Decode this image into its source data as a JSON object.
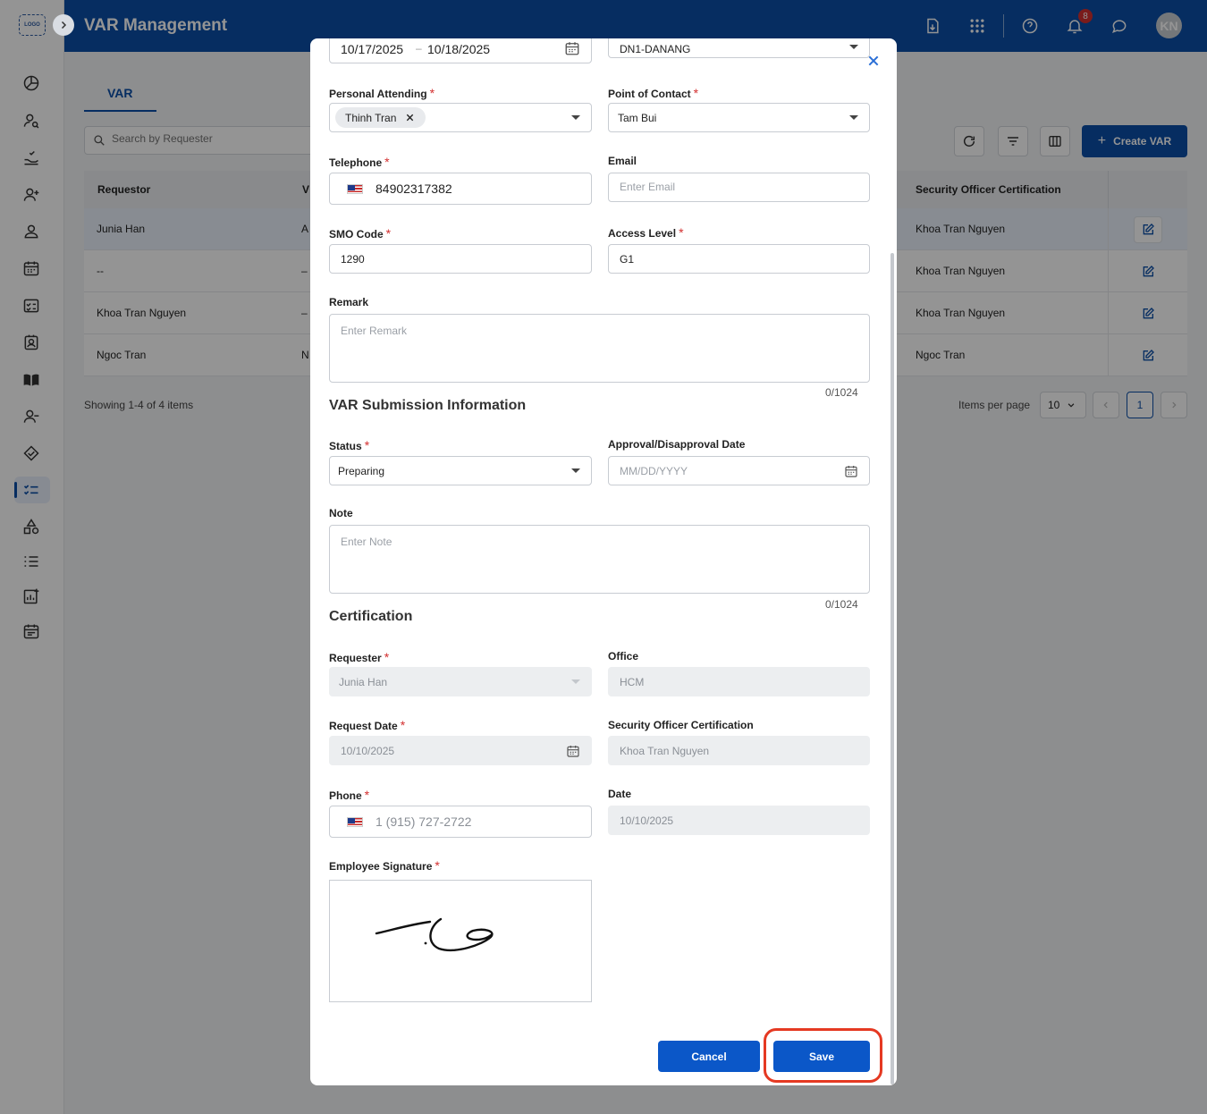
{
  "app": {
    "title": "VAR Management",
    "logo": "LOGO",
    "notification_count": "8",
    "avatar_initials": "KN"
  },
  "tabs": [
    {
      "label": "VAR"
    }
  ],
  "search": {
    "placeholder": "Search by Requester"
  },
  "toolbar": {
    "create_label": "Create VAR"
  },
  "table": {
    "headers": {
      "requestor": "Requestor",
      "v": "V",
      "soc": "Security Officer Certification"
    },
    "rows": [
      {
        "requestor": "Junia Han",
        "v": "A",
        "soc": "Khoa Tran Nguyen"
      },
      {
        "requestor": "--",
        "v": "–",
        "soc": "Khoa Tran Nguyen"
      },
      {
        "requestor": "Khoa Tran Nguyen",
        "v": "–",
        "soc": "Khoa Tran Nguyen"
      },
      {
        "requestor": "Ngoc Tran",
        "v": "N",
        "soc": "Ngoc Tran"
      }
    ]
  },
  "pagination": {
    "showing": "Showing 1-4 of 4 items",
    "items_per_page_label": "Items per page",
    "items_per_page": "10",
    "current_page": "1"
  },
  "modal": {
    "date_range": {
      "start": "10/17/2025",
      "separator": "–",
      "end": "10/18/2025"
    },
    "location": {
      "value": "DN1-DANANG"
    },
    "personal_attending": {
      "label": "Personal Attending",
      "chip": "Thinh Tran"
    },
    "point_of_contact": {
      "label": "Point of Contact",
      "value": "Tam Bui"
    },
    "telephone": {
      "label": "Telephone",
      "value": "84902317382"
    },
    "email": {
      "label": "Email",
      "placeholder": "Enter Email"
    },
    "smo_code": {
      "label": "SMO Code",
      "value": "1290"
    },
    "access_level": {
      "label": "Access Level",
      "value": "G1"
    },
    "remark": {
      "label": "Remark",
      "placeholder": "Enter Remark",
      "counter": "0/1024"
    },
    "submission_section": "VAR Submission Information",
    "status": {
      "label": "Status",
      "value": "Preparing"
    },
    "approval_date": {
      "label": "Approval/Disapproval Date",
      "placeholder": "MM/DD/YYYY"
    },
    "note": {
      "label": "Note",
      "placeholder": "Enter Note",
      "counter": "0/1024"
    },
    "certification_section": "Certification",
    "requester": {
      "label": "Requester",
      "value": "Junia Han"
    },
    "office": {
      "label": "Office",
      "value": "HCM"
    },
    "request_date": {
      "label": "Request Date",
      "value": "10/10/2025"
    },
    "security_officer_certification": {
      "label": "Security Officer Certification",
      "value": "Khoa Tran Nguyen"
    },
    "phone": {
      "label": "Phone",
      "value": "1 (915) 727-2722"
    },
    "date": {
      "label": "Date",
      "value": "10/10/2025"
    },
    "employee_signature": {
      "label": "Employee Signature"
    },
    "buttons": {
      "cancel": "Cancel",
      "save": "Save"
    }
  },
  "required_marker": "*",
  "colors": {
    "primary": "#0b4fa8",
    "button": "#0b57c8",
    "required": "#d32f2f",
    "highlight": "#e53922"
  }
}
